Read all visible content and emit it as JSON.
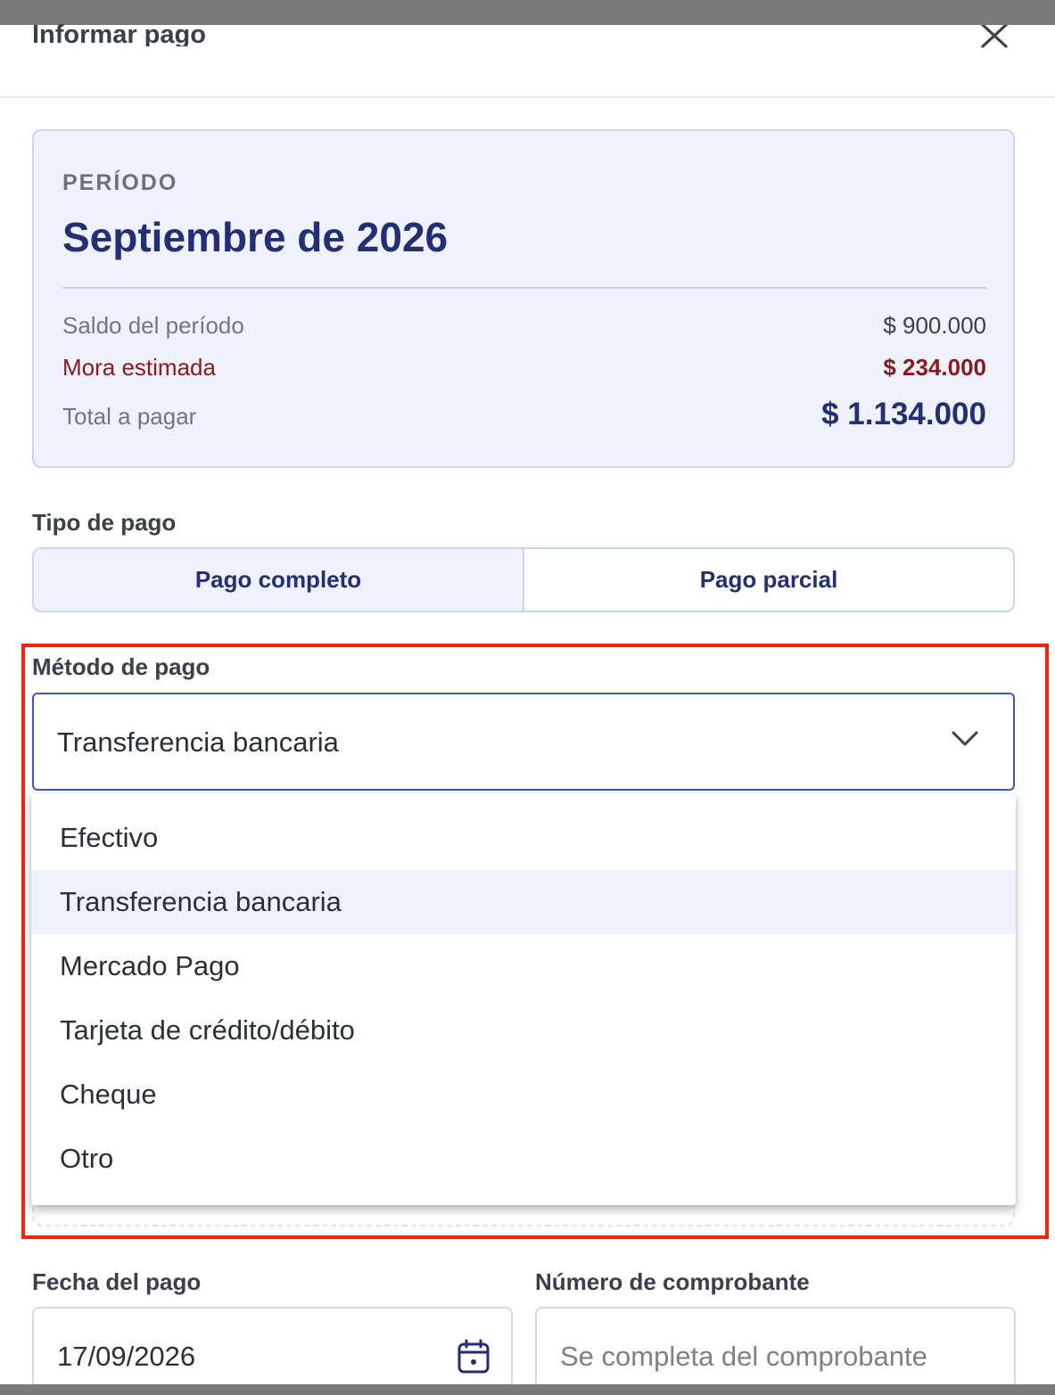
{
  "modal": {
    "title": "Informar pago"
  },
  "period_card": {
    "label": "PERÍODO",
    "value": "Septiembre de 2026",
    "rows": [
      {
        "label": "Saldo del período",
        "value": "$ 900.000"
      },
      {
        "label": "Mora estimada",
        "value": "$ 234.000"
      },
      {
        "label": "Total a pagar",
        "value": "$ 1.134.000"
      }
    ]
  },
  "payment_type": {
    "label": "Tipo de pago",
    "options": [
      "Pago completo",
      "Pago parcial"
    ],
    "selected": "Pago completo"
  },
  "payment_method": {
    "label": "Método de pago",
    "selected": "Transferencia bancaria",
    "options": [
      "Efectivo",
      "Transferencia bancaria",
      "Mercado Pago",
      "Tarjeta de crédito/débito",
      "Cheque",
      "Otro"
    ]
  },
  "payment_date": {
    "label": "Fecha del pago",
    "value": "17/09/2026"
  },
  "receipt_number": {
    "label": "Número de comprobante",
    "placeholder": "Se completa del comprobante"
  },
  "colors": {
    "primary": "#232f75",
    "accent_border": "#3d58b8",
    "danger": "#8b1a1a",
    "highlight": "#f5220c",
    "card_bg": "#eff2fc"
  },
  "icons": {
    "close": "close-icon",
    "chevron": "chevron-down-icon",
    "calendar": "calendar-icon"
  }
}
